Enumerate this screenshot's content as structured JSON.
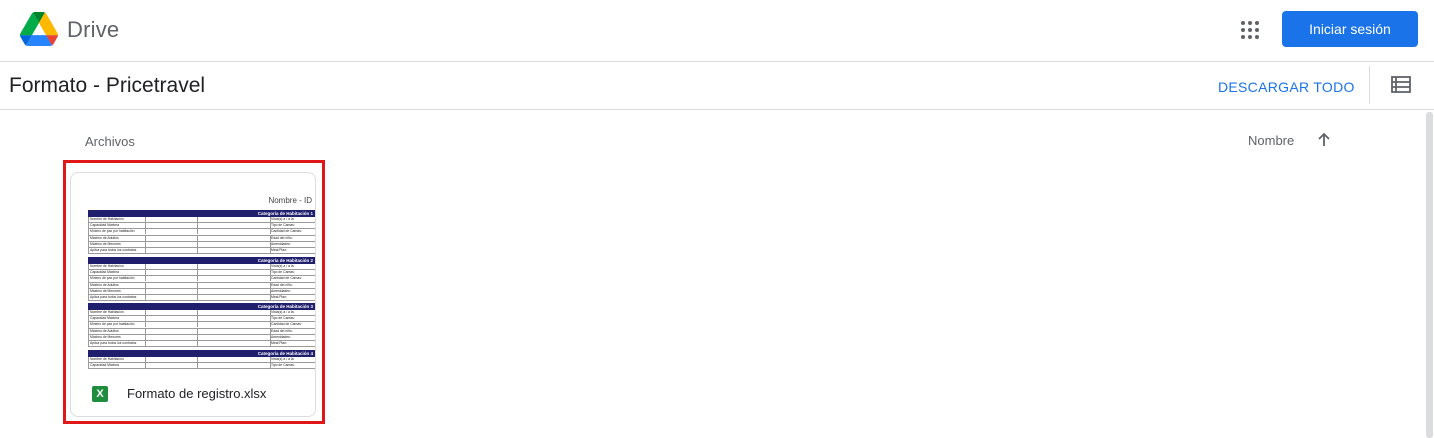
{
  "app": {
    "brand": "Drive",
    "signin_label": "Iniciar sesión"
  },
  "folder": {
    "title": "Formato - Pricetravel",
    "download_all_label": "DESCARGAR TODO"
  },
  "files_section": {
    "label": "Archivos",
    "sort_label": "Nombre",
    "sort_direction": "ascending"
  },
  "files": [
    {
      "name": "Formato de registro.xlsx",
      "type_icon": "X",
      "preview": {
        "header": "Nombre - ID",
        "categories": [
          {
            "title": "Categoría de Habitación 1",
            "rows": [
              [
                "Nombre de Habitación",
                "Vista(s) a / a la:"
              ],
              [
                "Capacidad Máxima",
                "Tipo de Camas:"
              ],
              [
                "Mínimo de pax por habitación",
                "Cantidad de Camas:"
              ],
              [
                "Máximo de Adultos",
                "Edad del niño:"
              ],
              [
                "Máximo de Menores",
                "Amenidades:"
              ],
              [
                "Aplica para todos los contratos",
                "Meal Plan:"
              ]
            ]
          },
          {
            "title": "Categoría de Habitación 2",
            "rows": [
              [
                "Nombre de Habitación",
                "Vista(s) a / a la:"
              ],
              [
                "Capacidad Máxima",
                "Tipo de Camas:"
              ],
              [
                "Mínimo de pax por habitación",
                "Cantidad de Camas:"
              ],
              [
                "Máximo de Adultos",
                "Edad del niño:"
              ],
              [
                "Máximo de Menores",
                "Amenidades:"
              ],
              [
                "Aplica para todos los contratos",
                "Meal Plan:"
              ]
            ]
          },
          {
            "title": "Categoría de Habitación 3",
            "rows": [
              [
                "Nombre de Habitación",
                "Vista(s) a / a la:"
              ],
              [
                "Capacidad Máxima",
                "Tipo de Camas:"
              ],
              [
                "Mínimo de pax por habitación",
                "Cantidad de Camas:"
              ],
              [
                "Máximo de Adultos",
                "Edad del niño:"
              ],
              [
                "Máximo de Menores",
                "Amenidades:"
              ],
              [
                "Aplica para todos los contratos",
                "Meal Plan:"
              ]
            ]
          },
          {
            "title": "Categoría de Habitación 4",
            "rows": [
              [
                "Nombre de Habitación",
                "Vista(s) a / a la:"
              ],
              [
                "Capacidad Máxima",
                "Tipo de Camas:"
              ]
            ]
          }
        ]
      }
    }
  ],
  "colors": {
    "accent": "#1a73e8",
    "highlight": "#e01717",
    "sheet_header": "#1f1f6e",
    "xlsx_green": "#1e8e3e"
  },
  "icons": {
    "logo": "google-drive-logo",
    "apps": "apps-grid-icon",
    "list_view": "list-view-icon",
    "sort": "arrow-up-icon",
    "file_type": "xlsx-icon"
  }
}
